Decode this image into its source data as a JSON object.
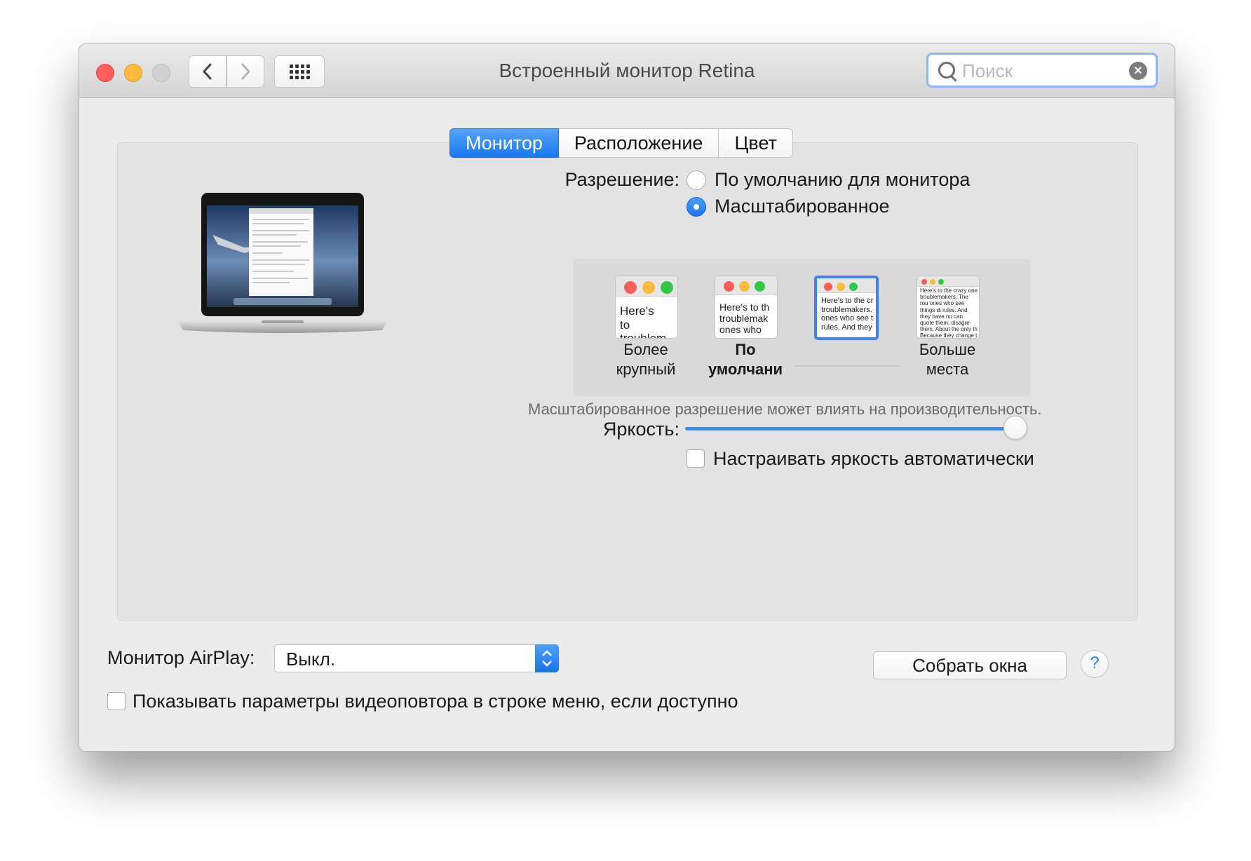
{
  "window": {
    "title": "Встроенный монитор Retina",
    "search_placeholder": "Поиск",
    "nav_back_icon": "chevron-left-icon",
    "nav_forward_icon": "chevron-right-icon",
    "show_all_icon": "grid-icon"
  },
  "tabs": [
    {
      "label": "Монитор",
      "active": true
    },
    {
      "label": "Расположение",
      "active": false
    },
    {
      "label": "Цвет",
      "active": false
    }
  ],
  "resolution": {
    "label": "Разрешение:",
    "options": [
      {
        "label": "По умолчанию для монитора",
        "selected": false
      },
      {
        "label": "Масштабированное",
        "selected": true
      }
    ],
    "scaled_options": [
      {
        "label_line1": "Более",
        "label_line2": "крупный",
        "preview_text": "Here's to troublem",
        "selected": false
      },
      {
        "label_line1": "По",
        "label_line2": "умолчани",
        "preview_text": "Here's to th troublemak ones who",
        "selected": false
      },
      {
        "label_line1": "",
        "label_line2": "",
        "preview_text": "Here's to the cr troublemakers. ones who see t rules. And they",
        "selected": true
      },
      {
        "label_line1": "Больше",
        "label_line2": "места",
        "preview_text": "Here's to the crazy one troublemakers. The rou ones who see things di rules. And they have no can quote them, disagre them. About the only th Because they change t",
        "selected": false
      }
    ],
    "note": "Масштабированное разрешение может влиять на производительность."
  },
  "brightness": {
    "label": "Яркость:",
    "value": 0.97,
    "auto_label": "Настраивать яркость автоматически",
    "auto_checked": false
  },
  "airplay": {
    "label": "Монитор AirPlay:",
    "value": "Выкл."
  },
  "mirror_option": {
    "label": "Показывать параметры видеоповтора в строке меню, если доступно",
    "checked": false
  },
  "gather_button": "Собрать окна",
  "help_icon": "?",
  "colors": {
    "accent": "#1a77f0",
    "close": "#fc605c",
    "minimize": "#fdbc40"
  }
}
